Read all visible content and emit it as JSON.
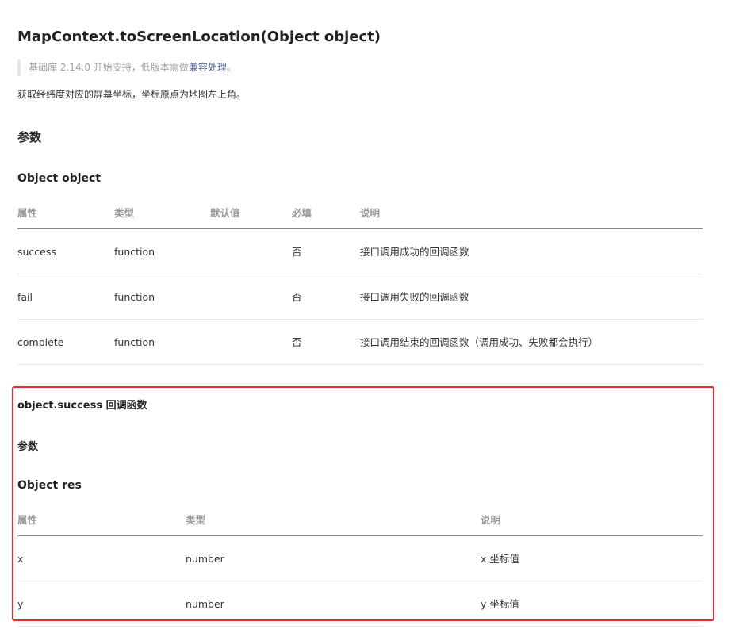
{
  "title": "MapContext.toScreenLocation(Object object)",
  "note": {
    "prefix": "基础库 2.14.0 开始支持，低版本需做",
    "link": "兼容处理",
    "suffix": "。"
  },
  "description": "获取经纬度对应的屏幕坐标，坐标原点为地图左上角。",
  "params_heading": "参数",
  "object_heading": "Object object",
  "params_table": {
    "headers": [
      "属性",
      "类型",
      "默认值",
      "必填",
      "说明"
    ],
    "rows": [
      [
        "success",
        "function",
        "",
        "否",
        "接口调用成功的回调函数"
      ],
      [
        "fail",
        "function",
        "",
        "否",
        "接口调用失败的回调函数"
      ],
      [
        "complete",
        "function",
        "",
        "否",
        "接口调用结束的回调函数（调用成功、失败都会执行）"
      ]
    ]
  },
  "callback": {
    "heading": "object.success 回调函数",
    "params_heading": "参数",
    "object_heading": "Object res",
    "table": {
      "headers": [
        "属性",
        "类型",
        "说明"
      ],
      "rows": [
        [
          "x",
          "number",
          "x 坐标值"
        ],
        [
          "y",
          "number",
          "y 坐标值"
        ]
      ]
    }
  },
  "colors": {
    "highlight_border": "#e32b2b",
    "link": "#576b95",
    "note_text": "#a0a0a0"
  }
}
